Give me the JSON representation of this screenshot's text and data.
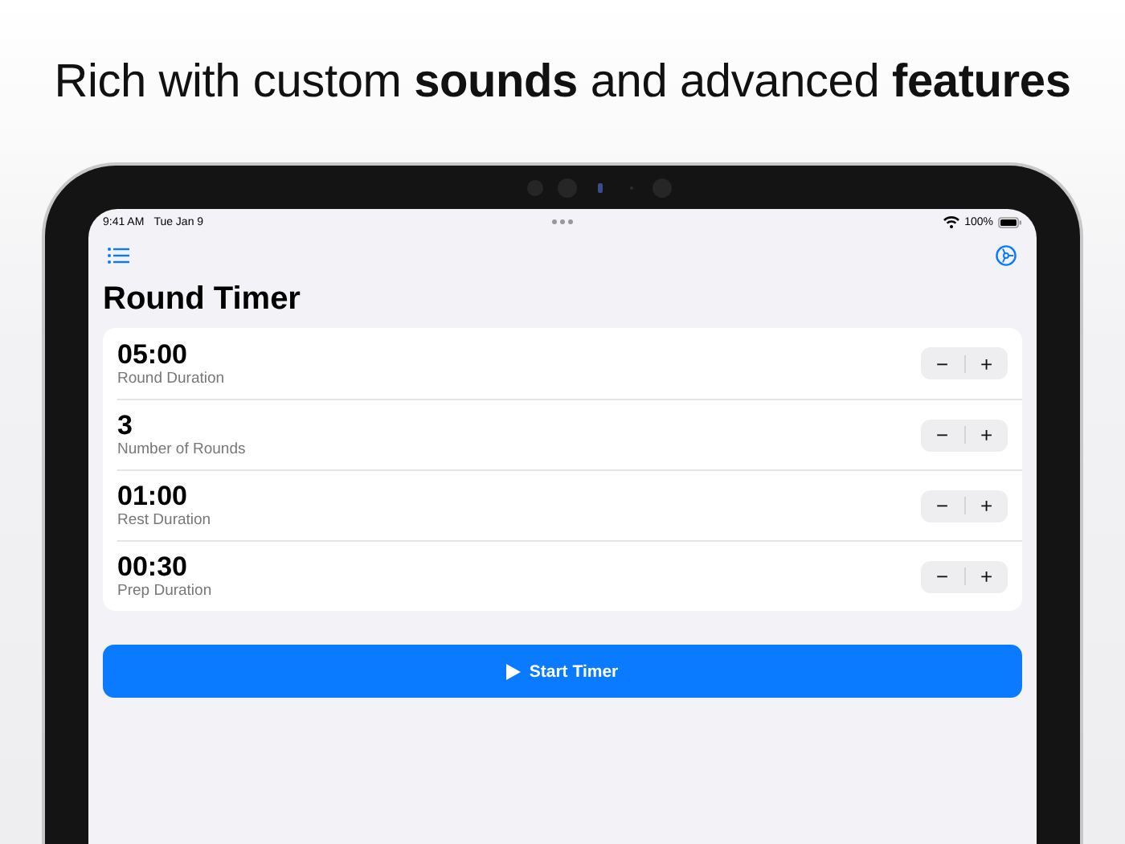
{
  "headline": "Rich with custom **sounds** and advanced **features**",
  "status_bar": {
    "time": "9:41 AM",
    "date": "Tue Jan 9",
    "battery": "100%"
  },
  "title": "Round Timer",
  "settings": [
    {
      "value": "05:00",
      "label": "Round Duration",
      "decrement": "−",
      "increment": "+"
    },
    {
      "value": "3",
      "label": "Number of Rounds",
      "decrement": "−",
      "increment": "+"
    },
    {
      "value": "01:00",
      "label": "Rest Duration",
      "decrement": "−",
      "increment": "+"
    },
    {
      "value": "00:30",
      "label": "Prep Duration",
      "decrement": "−",
      "increment": "+"
    }
  ],
  "start_button": {
    "label": "Start Timer"
  }
}
